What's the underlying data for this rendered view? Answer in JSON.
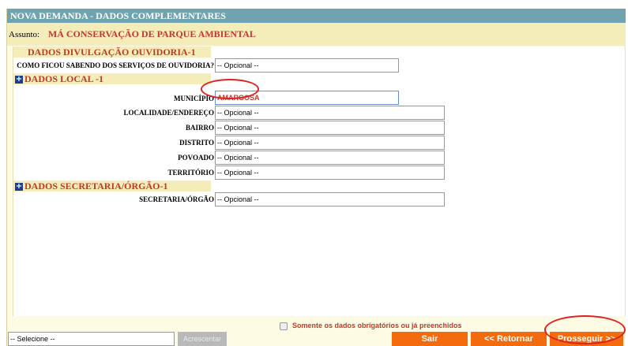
{
  "window": {
    "title": "NOVA DEMANDA - DADOS COMPLEMENTARES"
  },
  "assunto": {
    "label": "Assunto:",
    "value": "MÁ CONSERVAÇÃO DE PARQUE AMBIENTAL"
  },
  "sections": {
    "divulgacao": {
      "title": "DADOS DIVULGAÇÃO OUVIDORIA-1",
      "fields": [
        {
          "label": "COMO FICOU SABENDO DOS SERVIÇOS DE OUVIDORIA?",
          "value": "-- Opcional --"
        }
      ]
    },
    "local": {
      "title": "DADOS LOCAL -1",
      "fields": [
        {
          "label": "MUNICÍPIO",
          "value": "AMARGOSA"
        },
        {
          "label": "LOCALIDADE/ENDEREÇO",
          "value": "-- Opcional --"
        },
        {
          "label": "BAIRRO",
          "value": "-- Opcional --"
        },
        {
          "label": "DISTRITO",
          "value": "-- Opcional --"
        },
        {
          "label": "POVOADO",
          "value": "-- Opcional --"
        },
        {
          "label": "TERRITÓRIO",
          "value": "-- Opcional --"
        }
      ]
    },
    "secretaria": {
      "title": "DADOS SECRETARIA/ÓRGÃO-1",
      "fields": [
        {
          "label": "SECRETARIA/ÓRGÃO",
          "value": "-- Opcional --"
        }
      ]
    }
  },
  "footer": {
    "checkbox_label": "Somente os dados obrigatórios ou já preenchidos",
    "select_value": "-- Selecione --",
    "add_label": "Acrescentar",
    "exit_label": "Sair",
    "back_label": "<< Retornar",
    "next_label": "Prosseguir >>"
  }
}
